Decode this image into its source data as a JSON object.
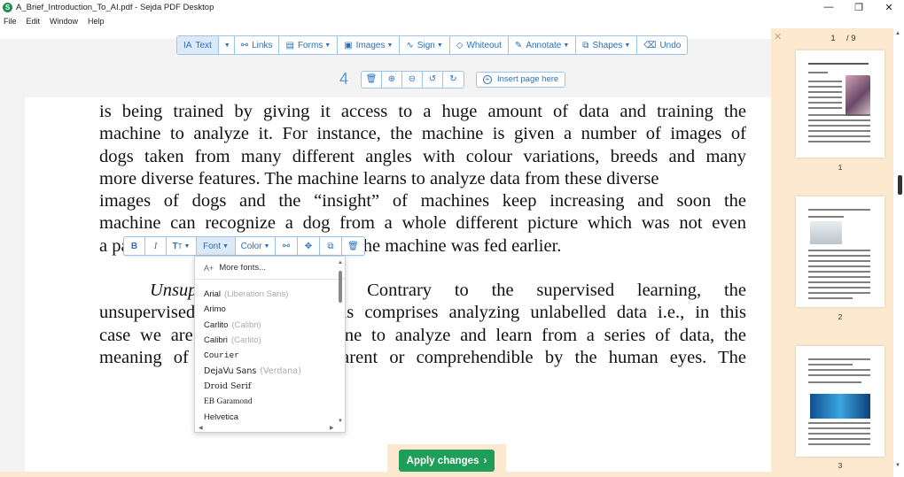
{
  "window": {
    "title": "A_Brief_Introduction_To_AI.pdf - Sejda PDF Desktop",
    "app_icon_letter": "S",
    "controls": [
      "—",
      "❐",
      "✕"
    ]
  },
  "menu": [
    "File",
    "Edit",
    "Window",
    "Help"
  ],
  "toolbar": {
    "text": "Text",
    "links": "Links",
    "forms": "Forms",
    "images": "Images",
    "sign": "Sign",
    "whiteout": "Whiteout",
    "annotate": "Annotate",
    "shapes": "Shapes",
    "undo": "Undo"
  },
  "page_controls": {
    "page_number": "4",
    "insert_label": "Insert page here"
  },
  "format_toolbar": {
    "bold": "B",
    "italic": "I",
    "size": "T",
    "font": "Font",
    "color": "Color"
  },
  "font_dropdown": {
    "more": "More fonts...",
    "fonts": [
      {
        "name": "Arial",
        "hint": "(Liberation Sans)"
      },
      {
        "name": "Arimo",
        "hint": ""
      },
      {
        "name": "Carlito",
        "hint": "(Calibri)"
      },
      {
        "name": "Calibri",
        "hint": "(Carlito)"
      },
      {
        "name": "Courier",
        "hint": ""
      },
      {
        "name": "DejaVu Sans",
        "hint": "(Verdana)"
      },
      {
        "name": "Droid Serif",
        "hint": ""
      },
      {
        "name": "EB Garamond",
        "hint": ""
      },
      {
        "name": "Helvetica",
        "hint": ""
      }
    ]
  },
  "document": {
    "lines": [
      "is being trained by giving it access to a huge amount of data and training the",
      "machine to analyze it. For instance, the machine is given a number of images of",
      "dogs taken from many different angles with colour variations, breeds and many",
      "more diverse features. The machine learns to analyze data from these diverse",
      "images of dogs and the “insight” of machines keep increasing and soon the",
      "machine can recognize a dog from a whole different picture which was not even",
      "a part of the data set of dog images the machine was fed earlier."
    ],
    "para2_italic": "Unsupervised Learning",
    "para2_lines": [
      ": Contrary to the supervised learning, the",
      "unsupervised learning algorithms comprises analyzing unlabelled data i.e., in this",
      "case we are training the machine to analyze and learn from a series of data, the",
      "meaning of which is not apparent or comprehendible by the human eyes. The"
    ]
  },
  "apply_button": "Apply changes",
  "sidebar": {
    "current_page": "1",
    "total": "/ 9",
    "thumbnails": [
      "1",
      "2",
      "3"
    ]
  }
}
